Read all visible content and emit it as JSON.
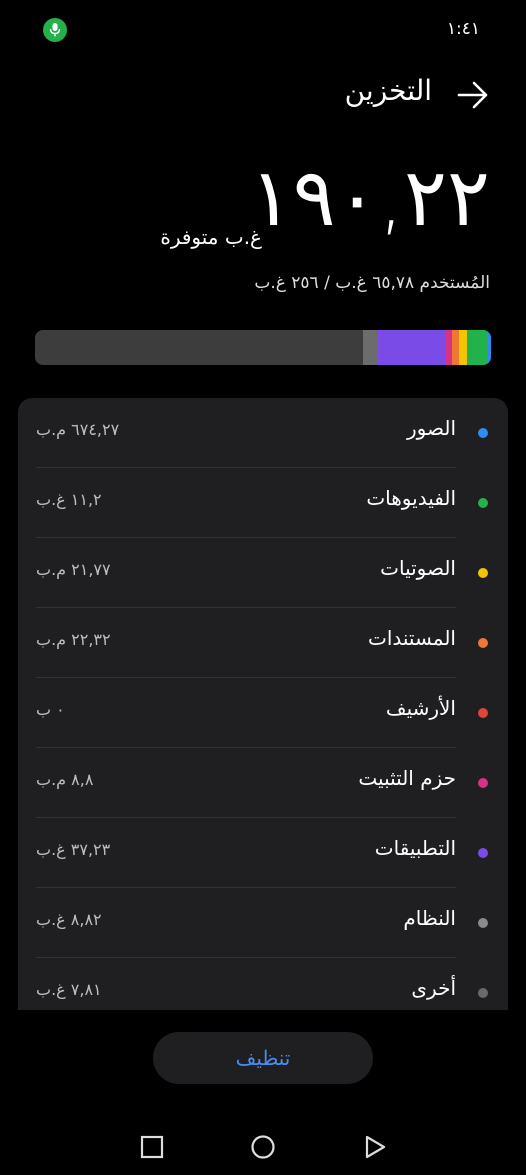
{
  "status_bar": {
    "time": "١:٤١"
  },
  "header": {
    "title": "التخزين"
  },
  "summary": {
    "free_value": "١٩٠,٢٢",
    "free_unit": "غ.ب متوفرة",
    "used_line": "المُستخدم ٦٥,٧٨ غ.ب / ٢٥٦ غ.ب"
  },
  "usage_bar": {
    "segments": [
      {
        "name": "system",
        "color": "#6c6c6c",
        "percent": 3.4
      },
      {
        "name": "apps",
        "color": "#7a4be6",
        "percent": 14.6
      },
      {
        "name": "install-packages",
        "color": "#d63384",
        "percent": 1.6
      },
      {
        "name": "docs",
        "color": "#ee7732",
        "percent": 1.5
      },
      {
        "name": "audio",
        "color": "#f2c500",
        "percent": 1.8
      },
      {
        "name": "videos",
        "color": "#22b24c",
        "percent": 4.3
      },
      {
        "name": "photos",
        "color": "#2f8cf0",
        "percent": 0.9
      }
    ]
  },
  "categories": [
    {
      "label": "الصور",
      "size": "٦٧٤,٢٧ م.ب",
      "color": "#2f8cf0"
    },
    {
      "label": "الفيديوهات",
      "size": "١١,٢ غ.ب",
      "color": "#22b24c"
    },
    {
      "label": "الصوتيات",
      "size": "٢١,٧٧ م.ب",
      "color": "#f2c500"
    },
    {
      "label": "المستندات",
      "size": "٢٢,٣٢ م.ب",
      "color": "#ee7732"
    },
    {
      "label": "الأرشيف",
      "size": "٠ ب",
      "color": "#e0443a"
    },
    {
      "label": "حزم التثبيت",
      "size": "٨,٨ م.ب",
      "color": "#d63384"
    },
    {
      "label": "التطبيقات",
      "size": "٣٧,٢٣ غ.ب",
      "color": "#7a4be6"
    },
    {
      "label": "النظام",
      "size": "٨,٨٢ غ.ب",
      "color": "#8a8a8a"
    },
    {
      "label": "أخرى",
      "size": "٧,٨١ غ.ب",
      "color": "#6a6a6a"
    }
  ],
  "clean_button": {
    "label": "تنظيف"
  }
}
